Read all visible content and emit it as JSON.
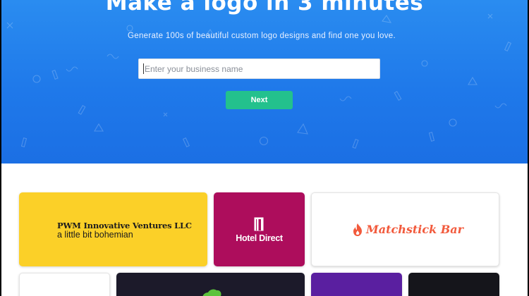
{
  "hero": {
    "title": "Make a logo in 3 minutes",
    "subtitle": "Generate 100s of beautiful custom logo designs and find one you love.",
    "search_placeholder": "Enter your business name",
    "next_label": "Next"
  },
  "gallery": {
    "cards": [
      {
        "name": "PWM Innovative Ventures LLC",
        "tagline": "a little bit bohemian",
        "bg": "#fbd028"
      },
      {
        "name": "Hotel Direct",
        "bg": "#ad0d5c",
        "icon": "door-icon"
      },
      {
        "name": "Matchstick Bar",
        "bg": "#ffffff",
        "color": "#f25a3c",
        "icon": "flame-icon"
      },
      {
        "bg": "#ffffff"
      },
      {
        "bg": "#1c1a2a",
        "icon": "leaf-blob-icon",
        "icon_color": "#5cc33b"
      },
      {
        "bg": "#5a1fa0"
      },
      {
        "bg": "#15151b"
      }
    ]
  },
  "colors": {
    "hero_blue": "#1f79ea",
    "accent_green": "#23c18d"
  }
}
